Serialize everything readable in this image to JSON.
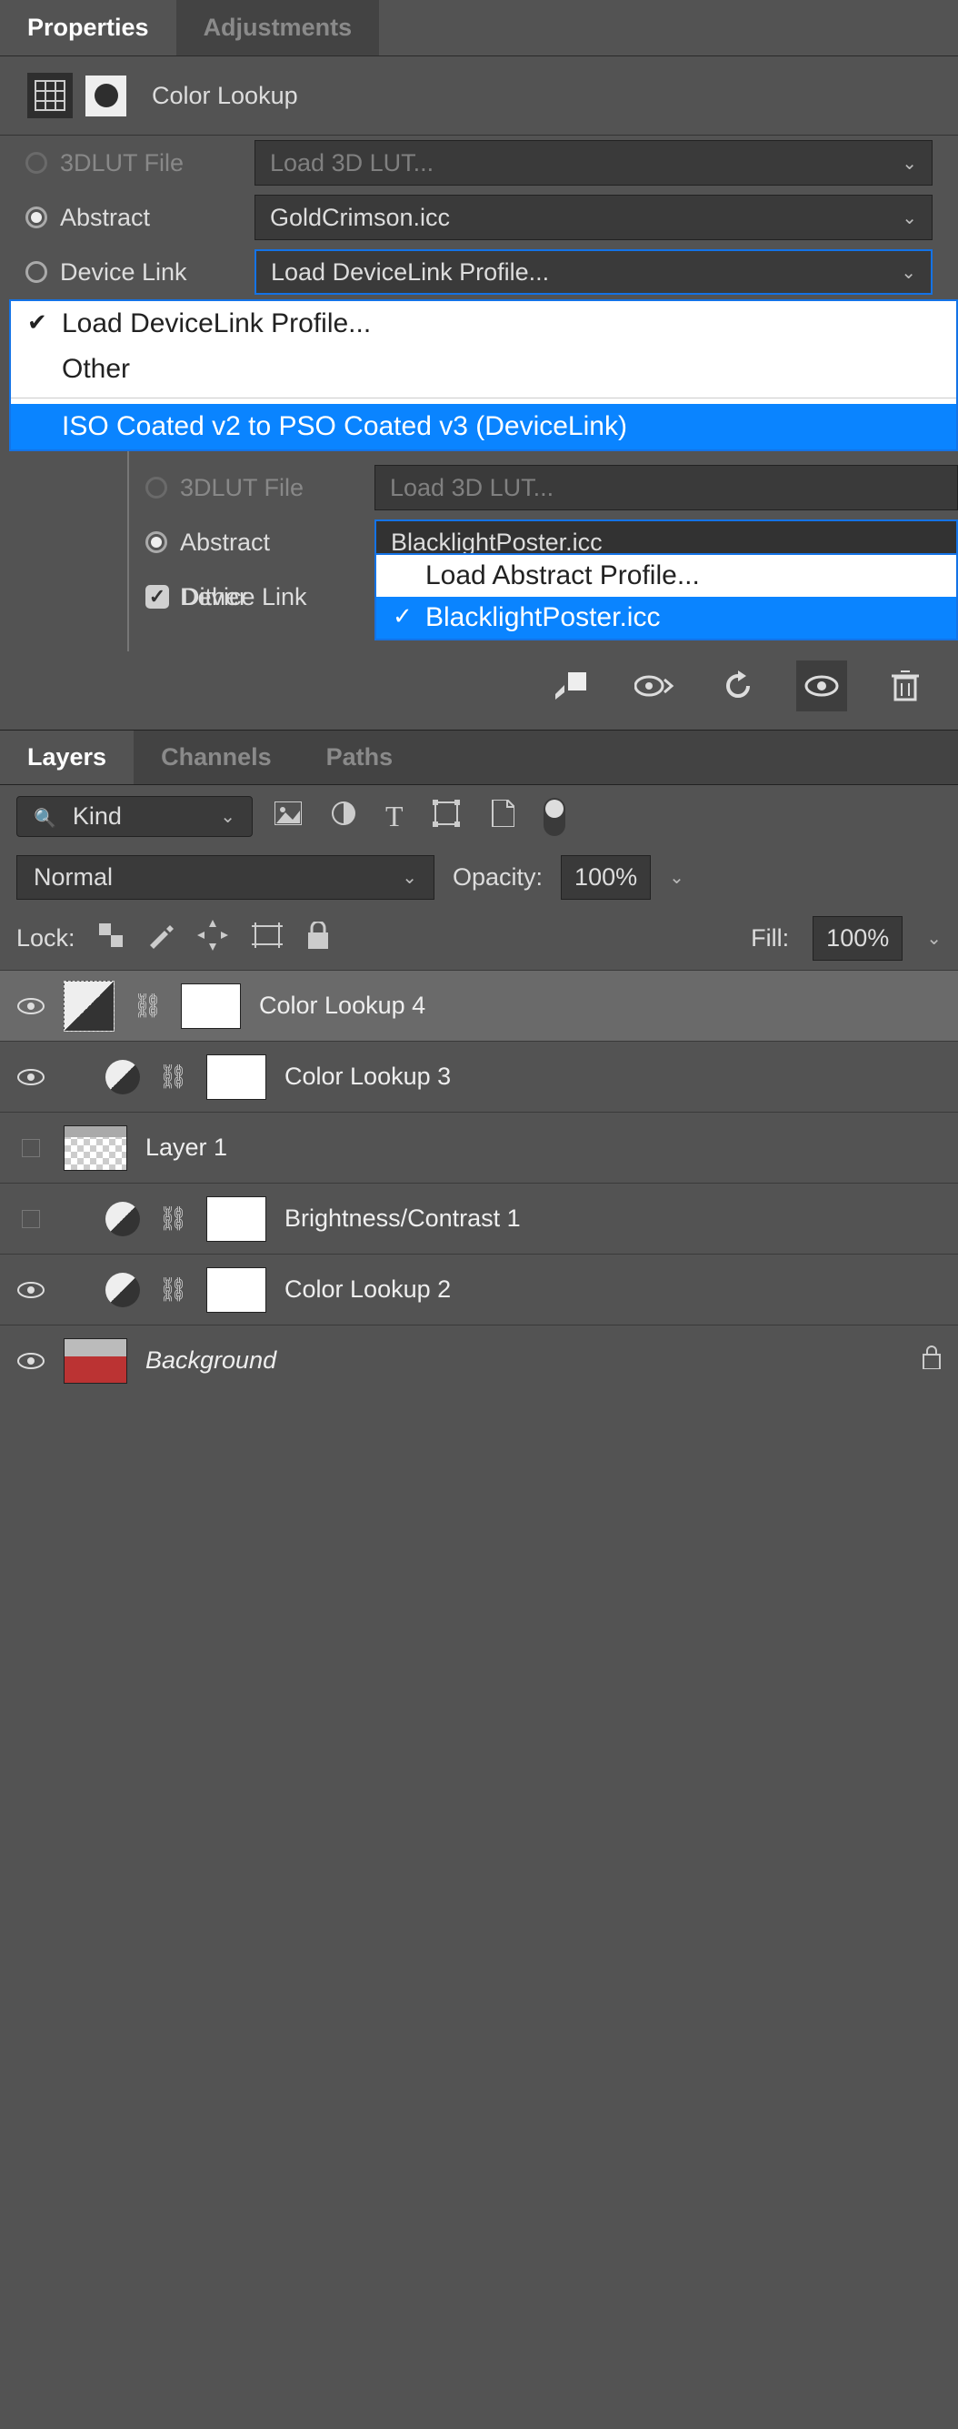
{
  "props": {
    "tab_properties": "Properties",
    "tab_adjustments": "Adjustments",
    "title": "Color Lookup",
    "row1": {
      "label": "3DLUT File",
      "dropdown": "Load 3D LUT..."
    },
    "row2": {
      "label": "Abstract",
      "dropdown": "GoldCrimson.icc"
    },
    "row3": {
      "label": "Device Link",
      "dropdown": "Load DeviceLink Profile..."
    },
    "menu": {
      "item1": "Load DeviceLink Profile...",
      "item2": "Other",
      "item3": "ISO Coated v2 to PSO Coated v3 (DeviceLink)"
    },
    "inner": {
      "row1": {
        "label": "3DLUT File",
        "dropdown": "Load 3D LUT..."
      },
      "row2": {
        "label": "Abstract",
        "dropdown": "BlacklightPoster.icc"
      },
      "row3": {
        "label": "Device Link"
      },
      "row4": {
        "label": "Dither"
      },
      "menu": {
        "i1": "Load Abstract Profile...",
        "i2": "BlacklightPoster.icc"
      }
    }
  },
  "layers": {
    "tab_layers": "Layers",
    "tab_channels": "Channels",
    "tab_paths": "Paths",
    "kind": "Kind",
    "blend": "Normal",
    "opacity_label": "Opacity:",
    "opacity_value": "100%",
    "lock_label": "Lock:",
    "fill_label": "Fill:",
    "fill_value": "100%",
    "items": [
      {
        "name": "Color Lookup 4"
      },
      {
        "name": "Color Lookup 3"
      },
      {
        "name": "Layer 1"
      },
      {
        "name": "Brightness/Contrast 1"
      },
      {
        "name": "Color Lookup 2"
      },
      {
        "name": "Background"
      }
    ]
  }
}
